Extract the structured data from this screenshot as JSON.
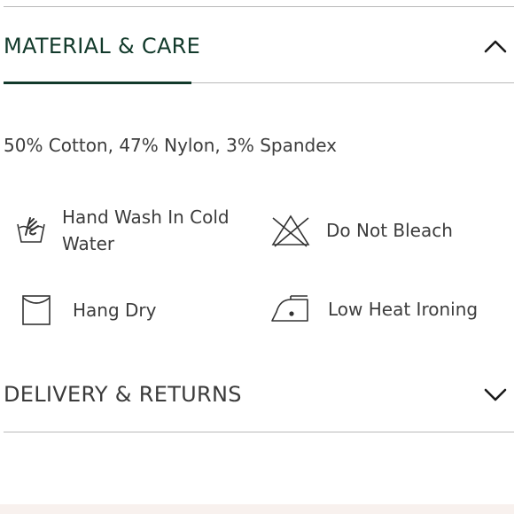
{
  "material_care": {
    "title": "MATERIAL & CARE",
    "expanded": true,
    "toggle_icon": "chevron-up-icon",
    "composition": "50% Cotton, 47% Nylon, 3% Spandex",
    "care_items": [
      {
        "label": "Hand Wash In Cold Water",
        "icon": "hand-wash-icon"
      },
      {
        "label": "Do Not Bleach",
        "icon": "do-not-bleach-icon"
      },
      {
        "label": "Hang Dry",
        "icon": "hang-dry-icon"
      },
      {
        "label": "Low Heat Ironing",
        "icon": "low-heat-iron-icon"
      }
    ]
  },
  "delivery_returns": {
    "title": "DELIVERY & RETURNS",
    "expanded": false,
    "toggle_icon": "chevron-down-icon"
  },
  "colors": {
    "accent": "#123a2b",
    "divider": "#b9b9b9",
    "text": "#3c3c3c",
    "footer": "#f8f1ee"
  }
}
